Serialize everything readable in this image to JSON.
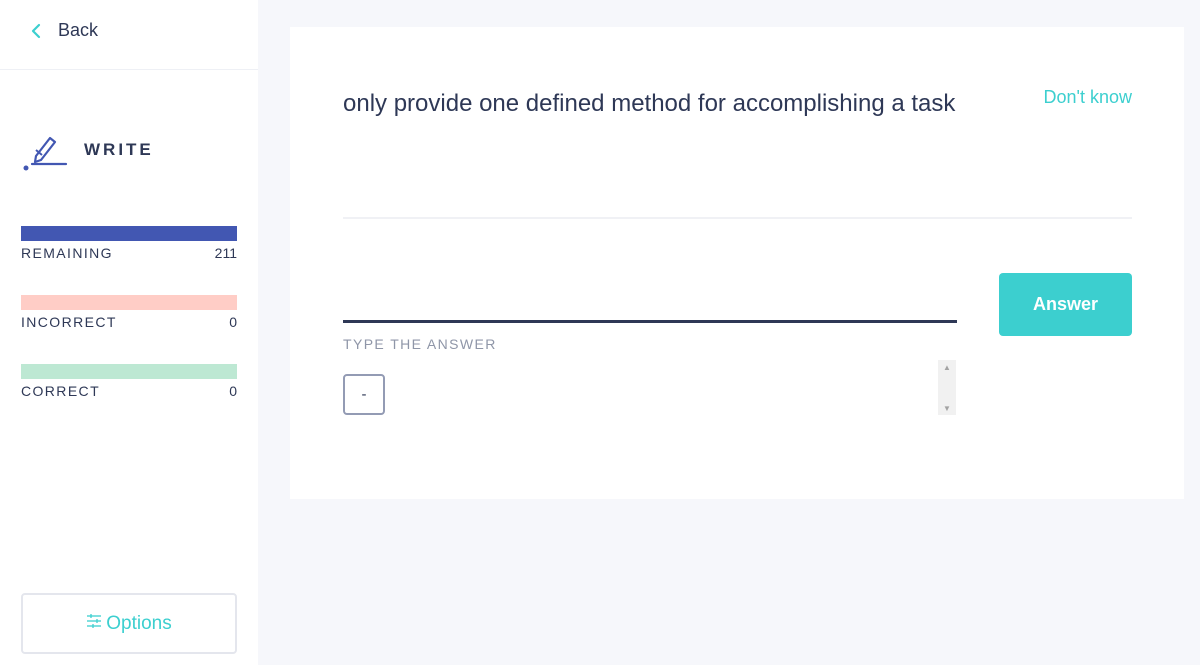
{
  "sidebar": {
    "back_label": "Back",
    "mode_label": "WRITE",
    "progress": [
      {
        "label": "REMAINING",
        "count": "211",
        "color": "#4257b2"
      },
      {
        "label": "INCORRECT",
        "count": "0",
        "color": "#ffcdc6"
      },
      {
        "label": "CORRECT",
        "count": "0",
        "color": "#bde8d3"
      }
    ],
    "options_label": "Options"
  },
  "card": {
    "prompt": "only provide one defined method for accomplishing a task",
    "dont_know_label": "Don't know",
    "answer_value": "",
    "answer_hint": "TYPE THE ANSWER",
    "special_char": "-",
    "answer_button_label": "Answer"
  },
  "colors": {
    "accent": "#3ccfcf",
    "text": "#2e3856",
    "muted": "#8f96a8"
  },
  "icons": {
    "back": "chevron-left-icon",
    "mode": "pen-write-icon",
    "options": "sliders-icon"
  }
}
